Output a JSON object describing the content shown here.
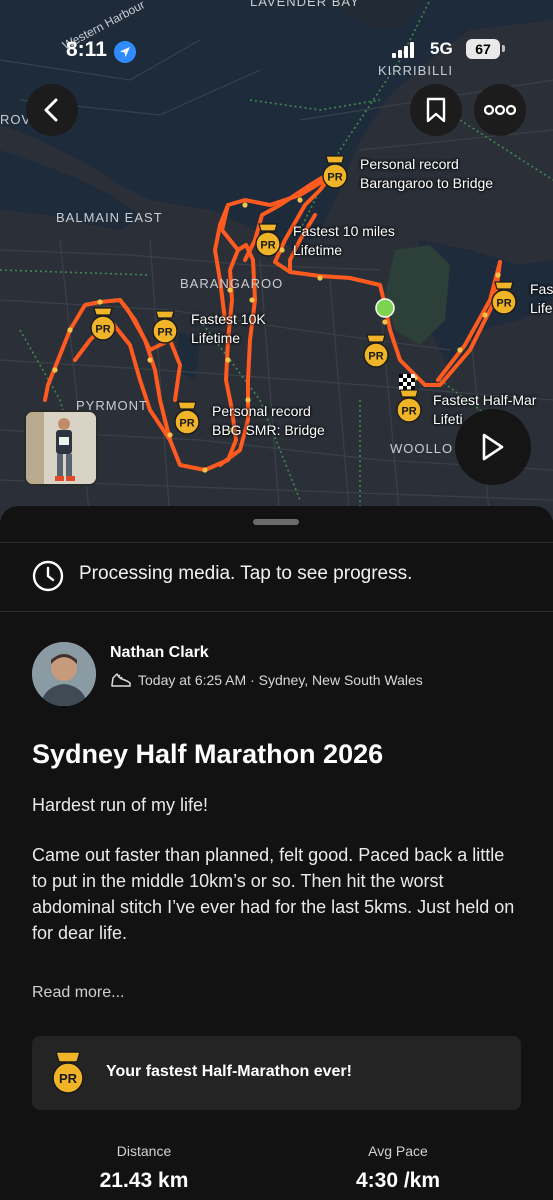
{
  "status_bar": {
    "time": "8:11",
    "network": "5G",
    "battery": "67"
  },
  "map": {
    "area_labels": [
      "LAVENDER BAY",
      "KIRRIBILLI",
      "BALMAIN EAST",
      "BARANGAROO",
      "PYRMONT",
      "WOOLLO",
      "Western Harbour"
    ],
    "partial_labels": [
      "ROV",
      "Fas",
      "Life"
    ],
    "achievements": [
      {
        "line1": "Personal record",
        "line2": "Barangaroo to Bridge"
      },
      {
        "line1": "Fastest 10 miles",
        "line2": "Lifetime"
      },
      {
        "line1": "Fastest 10K",
        "line2": "Lifetime"
      },
      {
        "line1": "Personal record",
        "line2": "BBG SMR: Bridge"
      },
      {
        "line1": "Fastest Half-Mar",
        "line2": "Lifeti"
      }
    ],
    "route_color": "#ff5a1f",
    "pr_badge_text": "PR",
    "pr_badge_color": "#f0b429"
  },
  "sheet": {
    "processing_text": "Processing media. Tap to see progress.",
    "athlete": {
      "name": "Nathan Clark",
      "meta": "Today at 6:25 AM · Sydney, New South Wales"
    },
    "title": "Sydney Half Marathon 2026",
    "description_line1": "Hardest run of my life!",
    "description_paragraph": "Came out faster than planned, felt good. Paced back a little to put in the middle 10km’s or so. Then hit the worst abdominal stitch I’ve ever had for the last 5kms. Just held on for dear life.",
    "read_more": "Read more...",
    "achievement_text": "Your fastest Half-Marathon ever!",
    "stats": [
      {
        "label": "Distance",
        "value": "21.43 km"
      },
      {
        "label": "Avg Pace",
        "value": "4:30 /km"
      }
    ]
  }
}
